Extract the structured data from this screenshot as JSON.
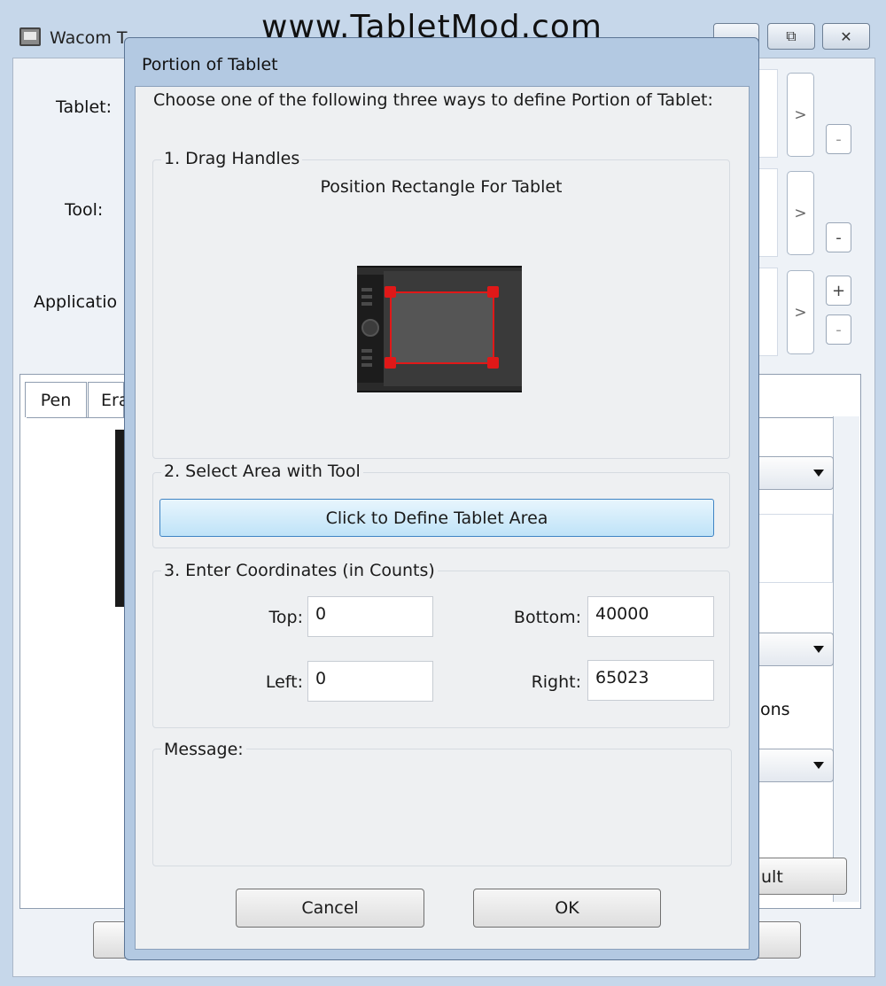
{
  "watermark": "www.TabletMod.com",
  "background_window": {
    "title": "Wacom T",
    "controls": {
      "minimize": "",
      "restore": "⧉",
      "close": "✕"
    },
    "labels": {
      "tablet": "Tablet:",
      "tool": "Tool:",
      "application": "Applicatio"
    },
    "tabs": [
      "Pen",
      "Era"
    ],
    "partial_texts": {
      "options": "ons",
      "default_button": "ult"
    },
    "arrow": ">",
    "minus": "-",
    "plus": "+"
  },
  "dialog": {
    "title": "Portion of Tablet",
    "instruction": "Choose one of the following three ways to define Portion of Tablet:",
    "group1": {
      "label": "1. Drag Handles",
      "caption": "Position Rectangle For Tablet"
    },
    "group2": {
      "label": "2. Select Area with Tool",
      "button": "Click to Define Tablet Area"
    },
    "group3": {
      "label": "3. Enter Coordinates (in Counts)",
      "fields": {
        "top": {
          "label": "Top:",
          "value": "0"
        },
        "bottom": {
          "label": "Bottom:",
          "value": "40000"
        },
        "left": {
          "label": "Left:",
          "value": "0"
        },
        "right": {
          "label": "Right:",
          "value": "65023"
        }
      }
    },
    "message": {
      "label": "Message:",
      "text": ""
    },
    "buttons": {
      "cancel": "Cancel",
      "ok": "OK"
    }
  }
}
